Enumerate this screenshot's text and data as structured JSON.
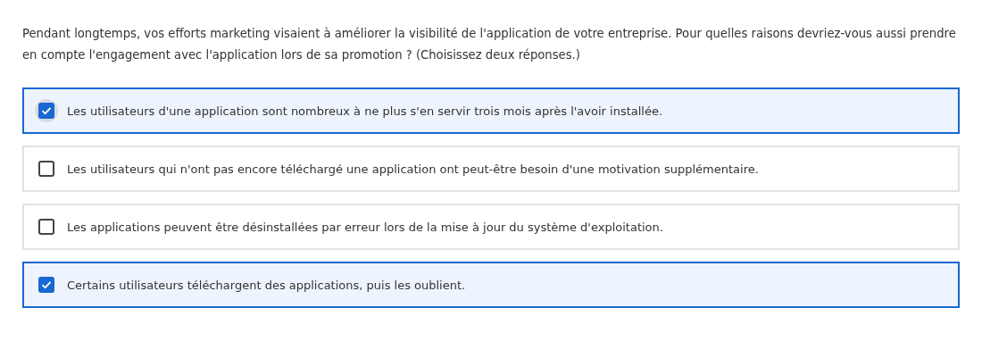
{
  "question": "Pendant longtemps, vos efforts marketing visaient à améliorer la visibilité de l'application de votre entreprise. Pour quelles raisons devriez-vous aussi prendre en compte l'engagement avec l'application lors de sa promotion ? (Choisissez deux réponses.)",
  "options": [
    {
      "label": "Les utilisateurs d'une application sont nombreux à ne plus s'en servir trois mois après l'avoir installée.",
      "checked": true,
      "focused": true
    },
    {
      "label": "Les utilisateurs qui n'ont pas encore téléchargé une application ont peut-être besoin d'une motivation supplémentaire.",
      "checked": false,
      "focused": false
    },
    {
      "label": "Les applications peuvent être désinstallées par erreur lors de la mise à jour du système d'exploitation.",
      "checked": false,
      "focused": false
    },
    {
      "label": "Certains utilisateurs téléchargent des applications, puis les oublient.",
      "checked": true,
      "focused": false
    }
  ]
}
